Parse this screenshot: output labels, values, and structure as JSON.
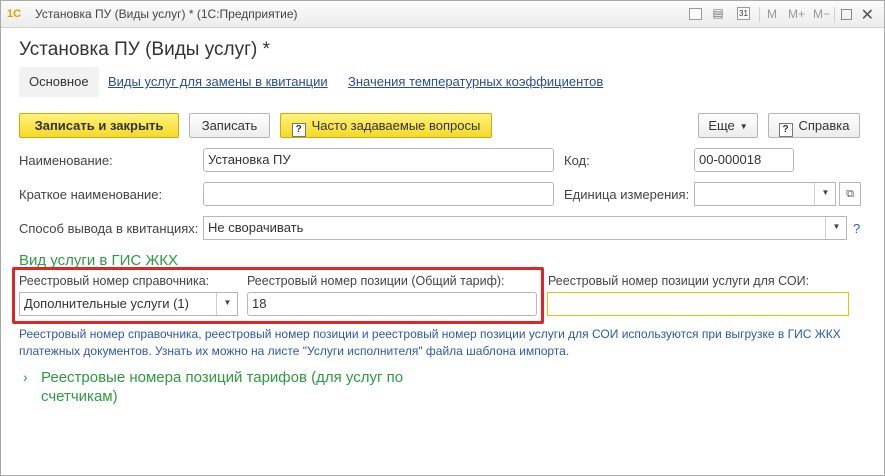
{
  "window": {
    "title": "Установка ПУ (Виды услуг) * (1С:Предприятие)",
    "logo_text": "1С",
    "toolbar_icons": [
      "document-icon",
      "calendar-icon",
      "m-icon",
      "m-plus-icon",
      "m-minus-icon",
      "restore-icon",
      "close-icon"
    ],
    "m_label": "M",
    "m_plus_label": "M+",
    "m_minus_label": "M−",
    "calendar_day": "31"
  },
  "form": {
    "title": "Установка ПУ (Виды услуг) *",
    "tabs": [
      {
        "label": "Основное",
        "active": true
      },
      {
        "label": "Виды услуг для замены в квитанции",
        "active": false
      },
      {
        "label": "Значения температурных коэффициентов",
        "active": false
      }
    ]
  },
  "toolbar": {
    "save_close": "Записать и закрыть",
    "save": "Записать",
    "faq": "Часто задаваемые вопросы",
    "more": "Еще",
    "help": "Справка",
    "help_q": "?"
  },
  "fields": {
    "name_label": "Наименование:",
    "name_value": "Установка ПУ",
    "code_label": "Код:",
    "code_value": "00-000018",
    "short_name_label": "Краткое наименование:",
    "short_name_value": "",
    "unit_label": "Единица измерения:",
    "unit_value": "",
    "output_label": "Способ вывода в квитанциях:",
    "output_value": "Не сворачивать"
  },
  "gis": {
    "section_title": "Вид услуги в ГИС ЖКХ",
    "registry_ref_label": "Реестровый номер справочника:",
    "registry_ref_value": "Дополнительные услуги (1)",
    "position_label": "Реестровый номер позиции (Общий тариф):",
    "position_value": "18",
    "soi_label": "Реестровый номер позиции услуги для СОИ:",
    "soi_value": "",
    "note": "Реестровый номер справочника, реестровый номер позиции и реестровый номер позиции услуги для СОИ используются при выгрузке в ГИС ЖКХ платежных документов. Узнать их можно на листе \"Услуги исполнителя\" файла шаблона импорта.",
    "expander_label": "Реестровые номера позиций тарифов (для услуг по счетчикам)"
  },
  "colors": {
    "accent_yellow": "#f5d927",
    "highlight_red": "#e0242a",
    "section_green": "#2e9a43",
    "link_blue": "#2a4f8f",
    "soi_border": "#e6c200"
  }
}
